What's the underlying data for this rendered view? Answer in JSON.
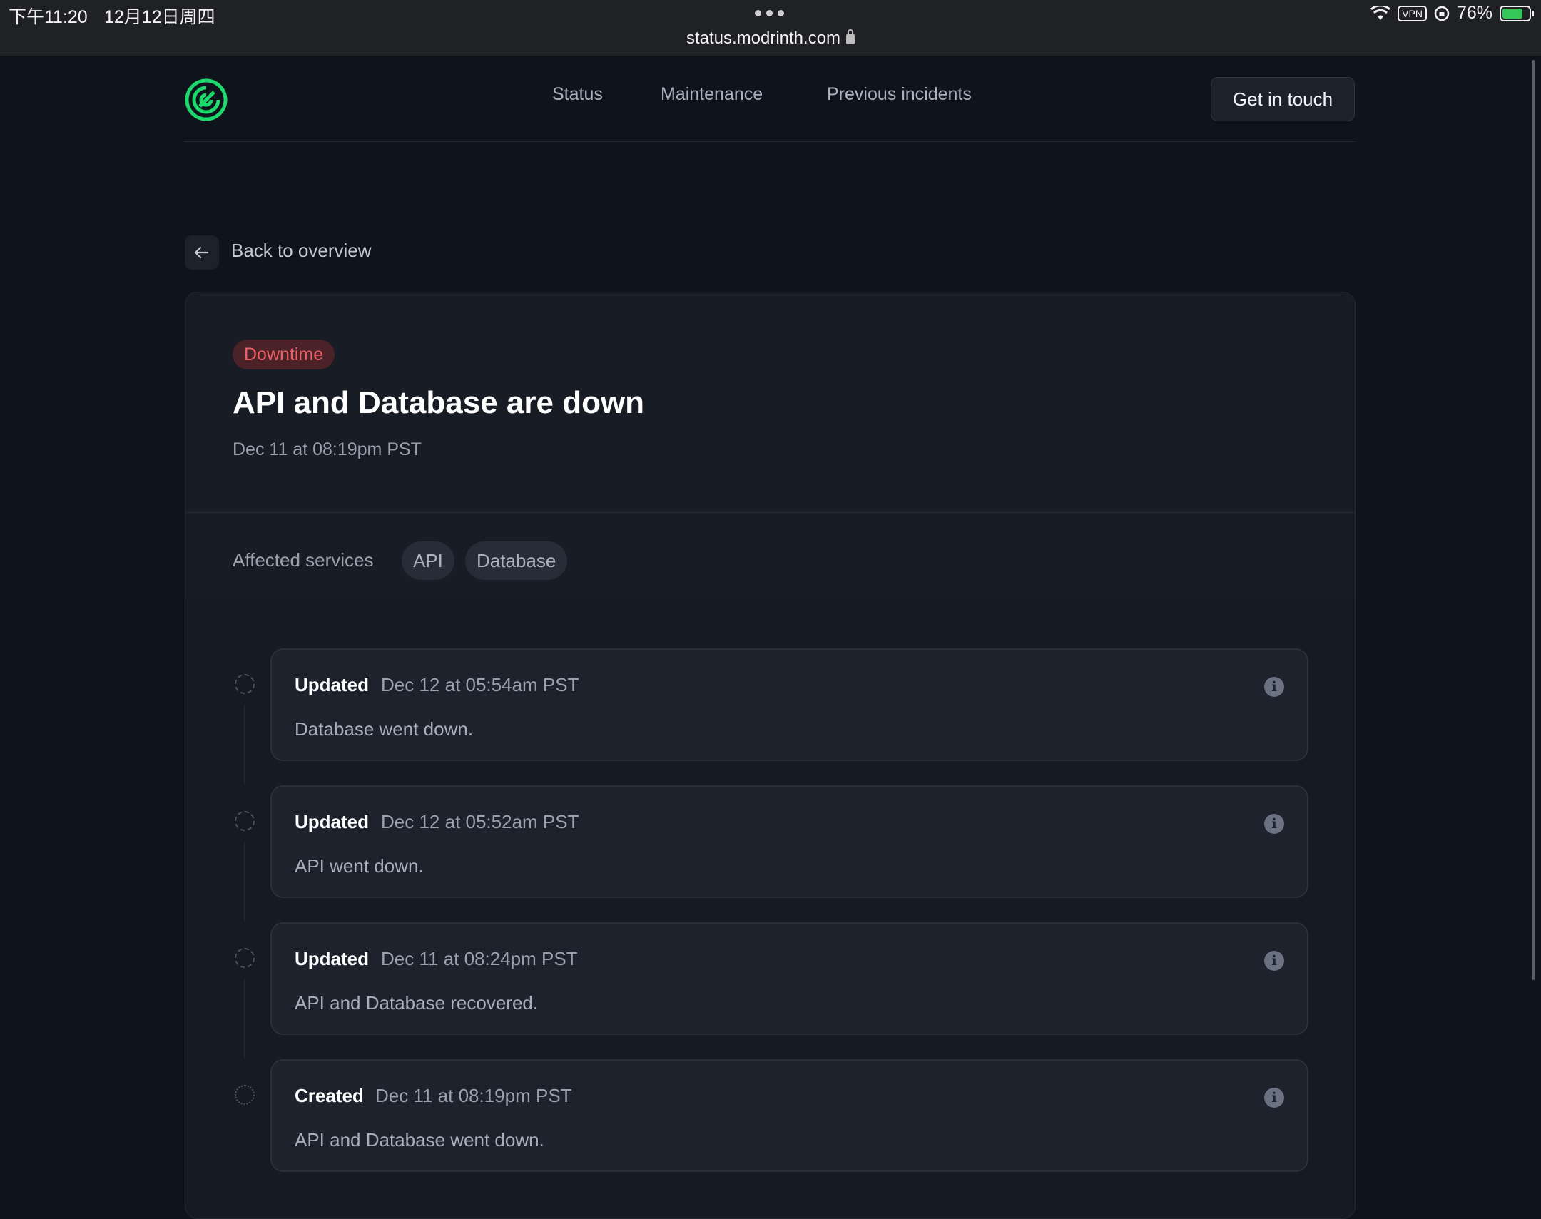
{
  "device": {
    "time": "下午11:20",
    "date": "12月12日周四",
    "url": "status.modrinth.com",
    "vpn_label": "VPN",
    "battery": "76%"
  },
  "header": {
    "nav": [
      "Status",
      "Maintenance",
      "Previous incidents"
    ],
    "cta": "Get in touch",
    "brand_color": "#1bd96a"
  },
  "back_link": "Back to overview",
  "incident": {
    "badge": "Downtime",
    "title": "API and Database are down",
    "date": "Dec 11 at 08:19pm PST",
    "affected_label": "Affected services",
    "services": [
      "API",
      "Database"
    ],
    "updates": [
      {
        "type": "Updated",
        "time": "Dec 12 at 05:54am PST",
        "message": "Database went down."
      },
      {
        "type": "Updated",
        "time": "Dec 12 at 05:52am PST",
        "message": "API went down."
      },
      {
        "type": "Updated",
        "time": "Dec 11 at 08:24pm PST",
        "message": "API and Database recovered."
      },
      {
        "type": "Created",
        "time": "Dec 11 at 08:19pm PST",
        "message": "API and Database went down."
      }
    ]
  }
}
